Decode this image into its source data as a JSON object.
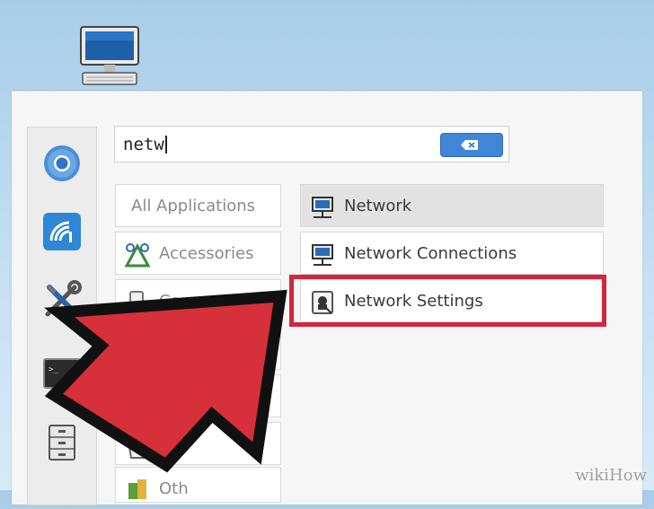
{
  "search": {
    "query": "netw"
  },
  "categories": [
    {
      "label": "All Applications",
      "icon": "none"
    },
    {
      "label": "Accessories",
      "icon": "accessories-icon"
    },
    {
      "label": "Co",
      "icon": "configuration-icon"
    },
    {
      "label": "",
      "icon": "none"
    },
    {
      "label": "",
      "icon": "none"
    },
    {
      "label": "ice",
      "icon": "office-icon"
    },
    {
      "label": "Oth",
      "icon": "other-icon"
    }
  ],
  "results": [
    {
      "label": "Network",
      "icon": "network-icon",
      "selected": true
    },
    {
      "label": "Network Connections",
      "icon": "network-connections-icon",
      "selected": false
    },
    {
      "label": "Network Settings",
      "icon": "network-settings-icon",
      "selected": false
    }
  ],
  "favorites": [
    "chrome-icon",
    "wireless-icon",
    "tools-icon",
    "terminal-icon",
    "file-cabinet-icon"
  ],
  "colors": {
    "highlight": "#d0273e",
    "arrow": "#d6303a",
    "accent": "#3f86d8"
  },
  "watermark": "wikiHow"
}
